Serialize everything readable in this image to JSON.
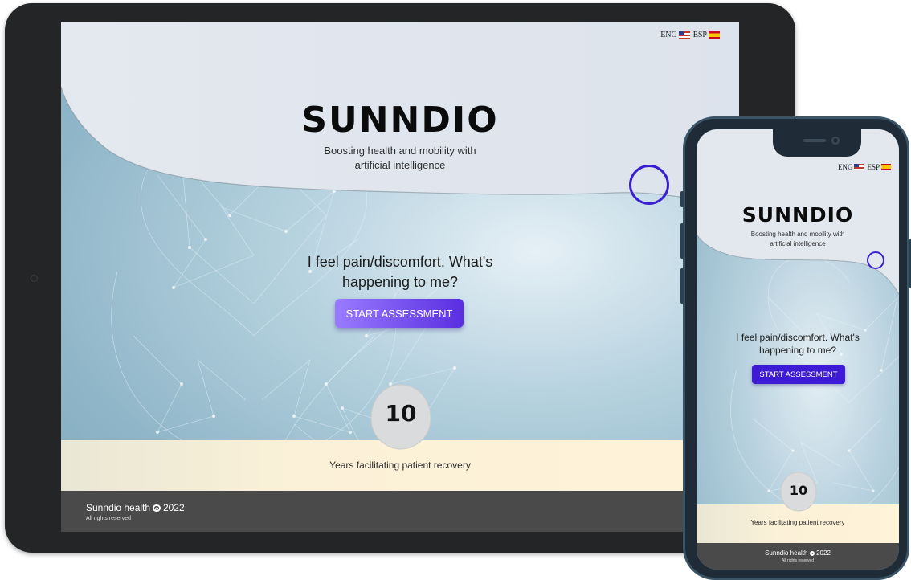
{
  "brand": "SUNNDIO",
  "tagline": "Boosting health and mobility with artificial intelligence",
  "languages": [
    {
      "code": "ENG",
      "flag": "us-flag-icon"
    },
    {
      "code": "ESP",
      "flag": "spain-flag-icon"
    }
  ],
  "hero": {
    "question": "I feel pain/discomfort. What's happening to me?",
    "cta": "START ASSESSMENT"
  },
  "stat": {
    "value": "10",
    "label": "Years facilitating patient recovery"
  },
  "footer": {
    "brand": "Sunndio health",
    "copyright_icon": "copyright-icon",
    "year": "2022",
    "rights": "All rights reserved"
  },
  "colors": {
    "accent": "#3d1bd6",
    "cta_gradient_start": "#9a7bff",
    "cta_gradient_end": "#5a2ee0",
    "footer_bg": "#4a4a4a",
    "band_bg": "#fff3d8"
  }
}
